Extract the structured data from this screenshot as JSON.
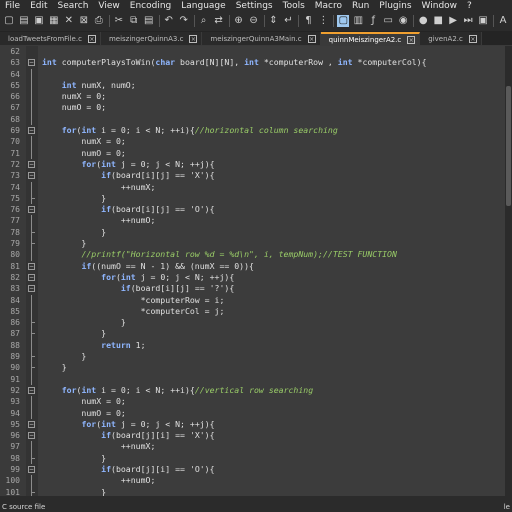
{
  "menu": [
    "File",
    "Edit",
    "Search",
    "View",
    "Encoding",
    "Language",
    "Settings",
    "Tools",
    "Macro",
    "Run",
    "Plugins",
    "Window",
    "?"
  ],
  "toolbar_icons": [
    {
      "name": "new-file-icon",
      "glyph": "▢"
    },
    {
      "name": "open-file-icon",
      "glyph": "▤"
    },
    {
      "name": "save-icon",
      "glyph": "▣"
    },
    {
      "name": "save-all-icon",
      "glyph": "▦"
    },
    {
      "name": "close-icon",
      "glyph": "✕"
    },
    {
      "name": "close-all-icon",
      "glyph": "⊠"
    },
    {
      "name": "print-icon",
      "glyph": "⎙"
    },
    {
      "name": "cut-icon",
      "glyph": "✂"
    },
    {
      "name": "copy-icon",
      "glyph": "⧉"
    },
    {
      "name": "paste-icon",
      "glyph": "▤"
    },
    {
      "name": "undo-icon",
      "glyph": "↶"
    },
    {
      "name": "redo-icon",
      "glyph": "↷"
    },
    {
      "name": "find-icon",
      "glyph": "⌕"
    },
    {
      "name": "replace-icon",
      "glyph": "⇄"
    },
    {
      "name": "zoom-in-icon",
      "glyph": "⊕"
    },
    {
      "name": "zoom-out-icon",
      "glyph": "⊖"
    },
    {
      "name": "sync-scroll-icon",
      "glyph": "⇕"
    },
    {
      "name": "word-wrap-icon",
      "glyph": "↵"
    },
    {
      "name": "show-all-chars-icon",
      "glyph": "¶"
    },
    {
      "name": "indent-guide-icon",
      "glyph": "⋮"
    },
    {
      "name": "user-language-icon",
      "glyph": "▢",
      "active": true
    },
    {
      "name": "document-map-icon",
      "glyph": "▥"
    },
    {
      "name": "function-list-icon",
      "glyph": "ƒ"
    },
    {
      "name": "folder-workspace-icon",
      "glyph": "▭"
    },
    {
      "name": "monitoring-icon",
      "glyph": "◉"
    },
    {
      "name": "record-macro-icon",
      "glyph": "●"
    },
    {
      "name": "stop-macro-icon",
      "glyph": "■"
    },
    {
      "name": "play-macro-icon",
      "glyph": "▶"
    },
    {
      "name": "run-macro-multiple-icon",
      "glyph": "⏭"
    },
    {
      "name": "save-macro-icon",
      "glyph": "▣"
    },
    {
      "name": "plugin-icon",
      "glyph": "A"
    }
  ],
  "tabs": [
    {
      "label": "loadTweetsFromFile.c",
      "active": false
    },
    {
      "label": "meiszingerQuinnA3.c",
      "active": false
    },
    {
      "label": "meiszingerQuinnA3Main.c",
      "active": false
    },
    {
      "label": "quinnMeiszingerA2.c",
      "active": true
    },
    {
      "label": "givenA2.c",
      "active": false
    }
  ],
  "code_lines": [
    {
      "n": "62",
      "segs": []
    },
    {
      "n": "63",
      "fold": "start",
      "segs": [
        {
          "t": "int",
          "c": "kw"
        },
        {
          "t": " computerPlaysToWin("
        },
        {
          "t": "char",
          "c": "kw"
        },
        {
          "t": " board[N][N], "
        },
        {
          "t": "int",
          "c": "kw"
        },
        {
          "t": " *computerRow , "
        },
        {
          "t": "int",
          "c": "kw"
        },
        {
          "t": " *computerCol){"
        }
      ]
    },
    {
      "n": "64",
      "fold": "line",
      "segs": []
    },
    {
      "n": "65",
      "fold": "line",
      "segs": [
        {
          "t": "    "
        },
        {
          "t": "int",
          "c": "kw"
        },
        {
          "t": " numX, numO;"
        }
      ]
    },
    {
      "n": "66",
      "fold": "line",
      "segs": [
        {
          "t": "    numX = 0;"
        }
      ]
    },
    {
      "n": "67",
      "fold": "line",
      "segs": [
        {
          "t": "    numO = 0;"
        }
      ]
    },
    {
      "n": "68",
      "fold": "line",
      "segs": []
    },
    {
      "n": "69",
      "fold": "start",
      "segs": [
        {
          "t": "    "
        },
        {
          "t": "for",
          "c": "kw"
        },
        {
          "t": "("
        },
        {
          "t": "int",
          "c": "kw"
        },
        {
          "t": " i = 0; i < N; ++i){"
        },
        {
          "t": "//horizontal column searching",
          "c": "cmt"
        }
      ]
    },
    {
      "n": "70",
      "fold": "line",
      "segs": [
        {
          "t": "        numX = 0;"
        }
      ]
    },
    {
      "n": "71",
      "fold": "line",
      "segs": [
        {
          "t": "        numO = 0;"
        }
      ]
    },
    {
      "n": "72",
      "fold": "start",
      "segs": [
        {
          "t": "        "
        },
        {
          "t": "for",
          "c": "kw"
        },
        {
          "t": "("
        },
        {
          "t": "int",
          "c": "kw"
        },
        {
          "t": " j = 0; j < N; ++j){"
        }
      ]
    },
    {
      "n": "73",
      "fold": "start",
      "segs": [
        {
          "t": "            "
        },
        {
          "t": "if",
          "c": "kw"
        },
        {
          "t": "(board[i][j] == 'X'){"
        }
      ]
    },
    {
      "n": "74",
      "fold": "line",
      "segs": [
        {
          "t": "                ++numX;"
        }
      ]
    },
    {
      "n": "75",
      "fold": "end",
      "segs": [
        {
          "t": "            }"
        }
      ]
    },
    {
      "n": "76",
      "fold": "start",
      "segs": [
        {
          "t": "            "
        },
        {
          "t": "if",
          "c": "kw"
        },
        {
          "t": "(board[i][j] == 'O'){"
        }
      ]
    },
    {
      "n": "77",
      "fold": "line",
      "segs": [
        {
          "t": "                ++numO;"
        }
      ]
    },
    {
      "n": "78",
      "fold": "end",
      "segs": [
        {
          "t": "            }"
        }
      ]
    },
    {
      "n": "79",
      "fold": "end",
      "segs": [
        {
          "t": "        }"
        }
      ]
    },
    {
      "n": "80",
      "fold": "line",
      "segs": [
        {
          "t": "        "
        },
        {
          "t": "//printf(\"Horizontal row %d = %d\\n\", i, tempNum);//TEST FUNCTION",
          "c": "cmt"
        }
      ]
    },
    {
      "n": "81",
      "fold": "start",
      "segs": [
        {
          "t": "        "
        },
        {
          "t": "if",
          "c": "kw"
        },
        {
          "t": "((numO == N - 1) && (numX == 0)){"
        }
      ]
    },
    {
      "n": "82",
      "fold": "start",
      "segs": [
        {
          "t": "            "
        },
        {
          "t": "for",
          "c": "kw"
        },
        {
          "t": "("
        },
        {
          "t": "int",
          "c": "kw"
        },
        {
          "t": " j = 0; j < N; ++j){"
        }
      ]
    },
    {
      "n": "83",
      "fold": "start",
      "segs": [
        {
          "t": "                "
        },
        {
          "t": "if",
          "c": "kw"
        },
        {
          "t": "(board[i][j] == '?'){"
        }
      ]
    },
    {
      "n": "84",
      "fold": "line",
      "segs": [
        {
          "t": "                    *computerRow = i;"
        }
      ]
    },
    {
      "n": "85",
      "fold": "line",
      "segs": [
        {
          "t": "                    *computerCol = j;"
        }
      ]
    },
    {
      "n": "86",
      "fold": "end",
      "segs": [
        {
          "t": "                }"
        }
      ]
    },
    {
      "n": "87",
      "fold": "end",
      "segs": [
        {
          "t": "            }"
        }
      ]
    },
    {
      "n": "88",
      "fold": "line",
      "segs": [
        {
          "t": "            "
        },
        {
          "t": "return",
          "c": "kw"
        },
        {
          "t": " 1;"
        }
      ]
    },
    {
      "n": "89",
      "fold": "end",
      "segs": [
        {
          "t": "        }"
        }
      ]
    },
    {
      "n": "90",
      "fold": "end",
      "segs": [
        {
          "t": "    }"
        }
      ]
    },
    {
      "n": "91",
      "fold": "line",
      "segs": []
    },
    {
      "n": "92",
      "fold": "start",
      "segs": [
        {
          "t": "    "
        },
        {
          "t": "for",
          "c": "kw"
        },
        {
          "t": "("
        },
        {
          "t": "int",
          "c": "kw"
        },
        {
          "t": " i = 0; i < N; ++i){"
        },
        {
          "t": "//vertical row searching",
          "c": "cmt"
        }
      ]
    },
    {
      "n": "93",
      "fold": "line",
      "segs": [
        {
          "t": "        numX = 0;"
        }
      ]
    },
    {
      "n": "94",
      "fold": "line",
      "segs": [
        {
          "t": "        numO = 0;"
        }
      ]
    },
    {
      "n": "95",
      "fold": "start",
      "segs": [
        {
          "t": "        "
        },
        {
          "t": "for",
          "c": "kw"
        },
        {
          "t": "("
        },
        {
          "t": "int",
          "c": "kw"
        },
        {
          "t": " j = 0; j < N; ++j){"
        }
      ]
    },
    {
      "n": "96",
      "fold": "start",
      "segs": [
        {
          "t": "            "
        },
        {
          "t": "if",
          "c": "kw"
        },
        {
          "t": "(board[j][i] == 'X'){"
        }
      ]
    },
    {
      "n": "97",
      "fold": "line",
      "segs": [
        {
          "t": "                ++numX;"
        }
      ]
    },
    {
      "n": "98",
      "fold": "end",
      "segs": [
        {
          "t": "            }"
        }
      ]
    },
    {
      "n": "99",
      "fold": "start",
      "segs": [
        {
          "t": "            "
        },
        {
          "t": "if",
          "c": "kw"
        },
        {
          "t": "(board[j][i] == 'O'){"
        }
      ]
    },
    {
      "n": "100",
      "fold": "line",
      "segs": [
        {
          "t": "                ++numO;"
        }
      ]
    },
    {
      "n": "101",
      "fold": "end",
      "segs": [
        {
          "t": "            }"
        }
      ]
    }
  ],
  "status": {
    "left": "C source file",
    "right": "le"
  },
  "colors": {
    "keyword": "#8fb6ff",
    "comment": "#9acd68",
    "background": "#3c3c3c",
    "active_tab_accent": "#f0a030"
  }
}
